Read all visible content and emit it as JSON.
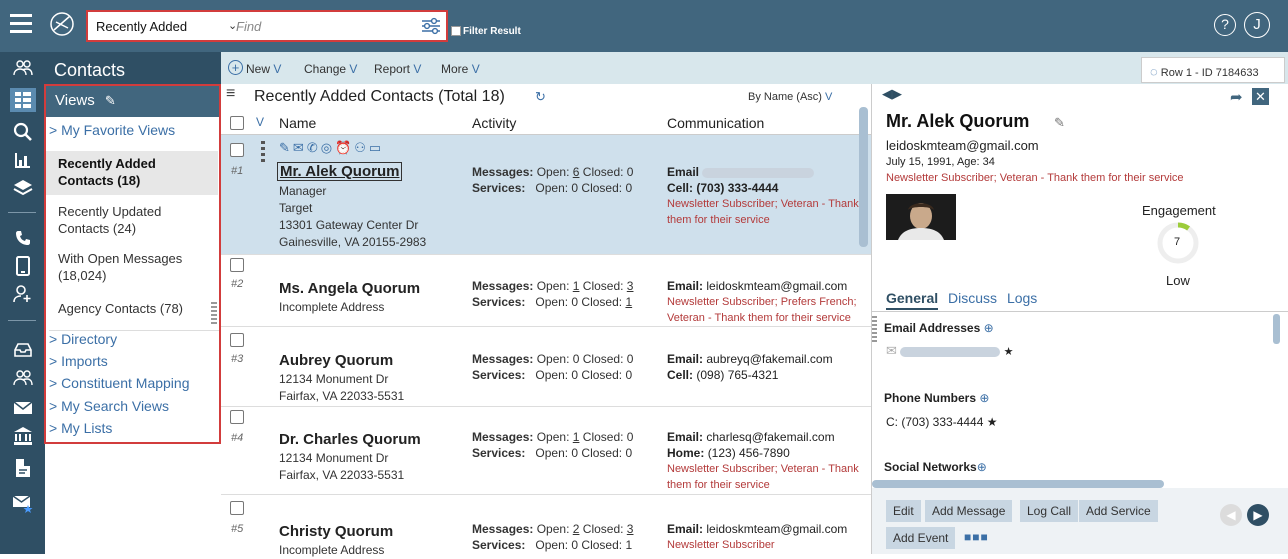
{
  "topbar": {
    "view_select": "Recently Added",
    "find_placeholder": "Find",
    "filter_label": "Filter Result",
    "help_glyph": "?",
    "user_initial": "J"
  },
  "nav": {
    "section_title": "Contacts"
  },
  "views": {
    "header": "Views",
    "favorite": "> My Favorite Views",
    "items": [
      {
        "label": "Recently Added Contacts (18)"
      },
      {
        "label": "Recently Updated Contacts (24)"
      },
      {
        "label": "With Open Messages (18,024)"
      },
      {
        "label": "Agency Contacts (78)"
      }
    ],
    "links": [
      "> Directory",
      "> Imports",
      "> Constituent Mapping",
      "> My Search Views",
      "> My Lists"
    ]
  },
  "toolbar": {
    "new": "New",
    "change": "Change",
    "report": "Report",
    "more": "More",
    "row_info": "Row 1 - ID 7184633"
  },
  "list": {
    "title": "Recently Added Contacts (Total 18)",
    "sort": "By Name (Asc)",
    "columns": {
      "name": "Name",
      "activity": "Activity",
      "communication": "Communication"
    },
    "rows": [
      {
        "num": "#1",
        "name": "Mr. Alek Quorum",
        "lines": [
          "Manager",
          "Target",
          "13301 Gateway Center Dr",
          "Gainesville, VA 20155-2983"
        ],
        "msg_label": "Messages:",
        "msg_open": "Open: ",
        "msg_open_n": "6",
        "msg_closed": " Closed: 0",
        "svc_label": "Services:",
        "svc_text": "Open: 0 Closed: 0",
        "c1_label": "Email",
        "c1_value": "",
        "c2_label": "Cell:",
        "c2_value": "(703) 333-4444",
        "note": "Newsletter Subscriber; Veteran - Thank them for their service"
      },
      {
        "num": "#2",
        "name": "Ms. Angela Quorum",
        "lines": [
          "Incomplete Address"
        ],
        "msg_label": "Messages:",
        "msg_open": "Open: ",
        "msg_open_n": "1",
        "msg_closed": " Closed: ",
        "msg_closed_n": "3",
        "svc_label": "Services:",
        "svc_open": "Open: 0 Closed: ",
        "svc_closed_n": "1",
        "c1_label": "Email:",
        "c1_value": "leidoskmteam@gmail.com",
        "note": "Newsletter Subscriber; Prefers French; Veteran - Thank them for their service"
      },
      {
        "num": "#3",
        "name": "Aubrey Quorum",
        "lines": [
          "12134 Monument Dr",
          "Fairfax, VA 22033-5531"
        ],
        "msg_label": "Messages:",
        "msg_text": "Open: 0 Closed: 0",
        "svc_label": "Services:",
        "svc_text": "Open: 0 Closed: 0",
        "c1_label": "Email:",
        "c1_value": "aubreyq@fakemail.com",
        "c2_label": "Cell:",
        "c2_value": "(098) 765-4321"
      },
      {
        "num": "#4",
        "name": "Dr. Charles Quorum",
        "lines": [
          "12134 Monument Dr",
          "Fairfax, VA 22033-5531"
        ],
        "msg_label": "Messages:",
        "msg_open": "Open: ",
        "msg_open_n": "1",
        "msg_closed": " Closed: 0",
        "svc_label": "Services:",
        "svc_text": "Open: 0 Closed: 0",
        "c1_label": "Email:",
        "c1_value": "charlesq@fakemail.com",
        "c2_label": "Home:",
        "c2_value": "(123) 456-7890",
        "note": "Newsletter Subscriber; Veteran - Thank them for their service"
      },
      {
        "num": "#5",
        "name": "Christy Quorum",
        "lines": [
          "Incomplete Address"
        ],
        "msg_label": "Messages:",
        "msg_open": "Open: ",
        "msg_open_n": "2",
        "msg_closed": " Closed: ",
        "msg_closed_n": "3",
        "svc_label": "Services:",
        "svc_text": "Open: 0 Closed: 1",
        "c1_label": "Email:",
        "c1_value": "leidoskmteam@gmail.com",
        "note": "Newsletter Subscriber"
      }
    ]
  },
  "detail": {
    "name": "Mr. Alek Quorum",
    "email": "leidoskmteam@gmail.com",
    "dob": "July 15, 1991, Age: 34",
    "tags": "Newsletter Subscriber; Veteran - Thank them for their service",
    "engagement_label": "Engagement",
    "engagement_value": "7",
    "engagement_fraction": 0.1,
    "engagement_level": "Low",
    "tabs": [
      "General",
      "Discuss",
      "Logs"
    ],
    "email_section": "Email Addresses",
    "phone_section": "Phone Numbers",
    "phone_value": "C: (703) 333-4444",
    "star": "★",
    "social_section": "Social Networks",
    "actions": [
      "Edit",
      "Add Message",
      "Log Call",
      "Add Service",
      "Add Event"
    ]
  },
  "colors": {
    "topbar": "#41667e",
    "rail": "#2f4f64",
    "toolbar": "#d8e7ec",
    "selected_row": "#cfe0ec",
    "link": "#3b6fa6",
    "note": "#b33a3a",
    "highlight_border": "#d23c3c"
  }
}
